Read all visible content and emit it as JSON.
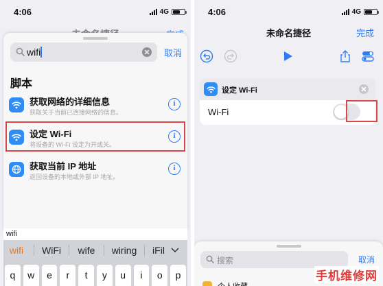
{
  "left_screen": {
    "status": {
      "time": "4:06",
      "network": "4G"
    },
    "background_title": "未命名捷径",
    "background_done": "完成",
    "search": {
      "value": "wifi",
      "cancel_label": "取消"
    },
    "section_title": "脚本",
    "actions": [
      {
        "icon": "wifi-icon",
        "title": "获取网络的详细信息",
        "subtitle": "获取关于当前已连接网络的信息。"
      },
      {
        "icon": "wifi-icon",
        "title": "设定 Wi-Fi",
        "subtitle": "将设备的 Wi-Fi 设定为开或关。",
        "highlighted": true
      },
      {
        "icon": "wifi-icon",
        "title": "获取当前 IP 地址",
        "subtitle": "返回设备的本地或外部 IP 地址。"
      }
    ],
    "keyboard": {
      "typed_text": "wifi",
      "suggestions": [
        "wifi",
        "WiFi",
        "wife",
        "wiring",
        "iFil"
      ],
      "keys": [
        "q",
        "w",
        "e",
        "r",
        "t",
        "y",
        "u",
        "i",
        "o",
        "p"
      ]
    }
  },
  "right_screen": {
    "status": {
      "time": "4:06",
      "network": "4G"
    },
    "title": "未命名捷径",
    "done_label": "完成",
    "toolbar_icons": [
      "undo-icon",
      "redo-icon",
      "play-icon",
      "share-icon",
      "settings-toggle-icon"
    ],
    "action_card": {
      "title": "设定 Wi-Fi",
      "param_label": "Wi-Fi",
      "toggle_on": false
    },
    "bottom_panel": {
      "search_placeholder": "搜索",
      "cancel_label": "取消",
      "partial_item": "个人收藏"
    }
  },
  "watermark": "手机维修网",
  "colors": {
    "accent": "#2f7cf6",
    "highlight": "#d8474a",
    "suggestion_active": "#e27a29",
    "watermark": "#e03b3b"
  }
}
